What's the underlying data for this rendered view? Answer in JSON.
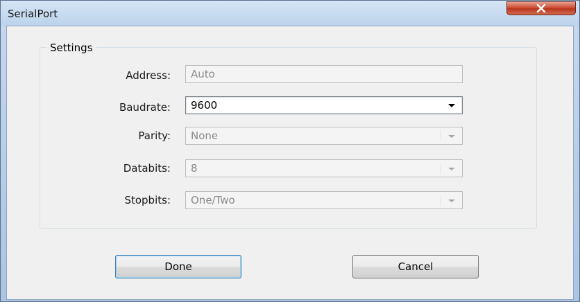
{
  "window": {
    "title": "SerialPort"
  },
  "icons": {
    "close": "close-icon",
    "dropdown": "chevron-down-icon"
  },
  "settings": {
    "group_label": "Settings",
    "address": {
      "label": "Address:",
      "value": "Auto",
      "enabled": false
    },
    "baudrate": {
      "label": "Baudrate:",
      "value": "9600",
      "enabled": true
    },
    "parity": {
      "label": "Parity:",
      "value": "None",
      "enabled": false
    },
    "databits": {
      "label": "Databits:",
      "value": "8",
      "enabled": false
    },
    "stopbits": {
      "label": "Stopbits:",
      "value": "One/Two",
      "enabled": false
    }
  },
  "buttons": {
    "done": "Done",
    "cancel": "Cancel"
  },
  "colors": {
    "close_button": "#c9442a",
    "focus_border": "#3c7fb1"
  }
}
